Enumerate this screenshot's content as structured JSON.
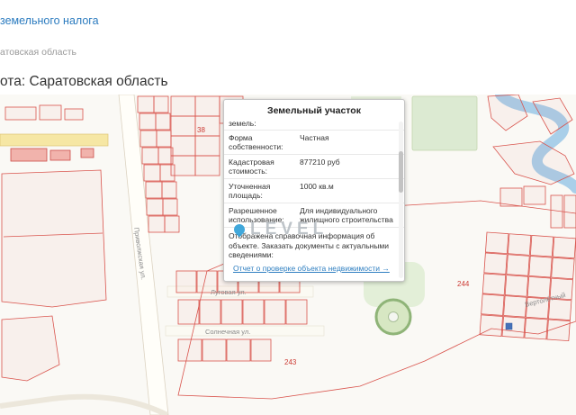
{
  "header": {
    "top_link": "земельного налога",
    "breadcrumb": "атовская область",
    "title": "ота: Саратовская область"
  },
  "popup": {
    "title": "Земельный участок",
    "partial_row_label": "земель:",
    "rows": [
      {
        "label": "Форма собственности:",
        "value": "Частная"
      },
      {
        "label": "Кадастровая стоимость:",
        "value": "877210 руб"
      },
      {
        "label": "Уточненная площадь:",
        "value": "1000 кв.м"
      },
      {
        "label": "Разрешенное использование:",
        "value": "Для индивидуального жилищного строительства"
      }
    ],
    "note": "Отображена справочная информация об объекте. Заказать документы с актуальными сведениями:",
    "link": "Отчет о проверке объекта недвижимости →"
  },
  "map": {
    "streets": {
      "privolzhskaya": "Приволжская ул.",
      "lugovaya": "Луговая ул.",
      "solnechnaya": "Солнечная ул.",
      "vertoletny": "Вертолётный"
    },
    "parcel_numbers": {
      "n38": "38",
      "n244": "244",
      "n243": "243"
    },
    "watermark": "LEVEL"
  },
  "colors": {
    "link_blue": "#2b7bbf",
    "parcel_red": "#d9544d",
    "river_blue": "#a9cfe9",
    "green_area": "#dcead2"
  }
}
